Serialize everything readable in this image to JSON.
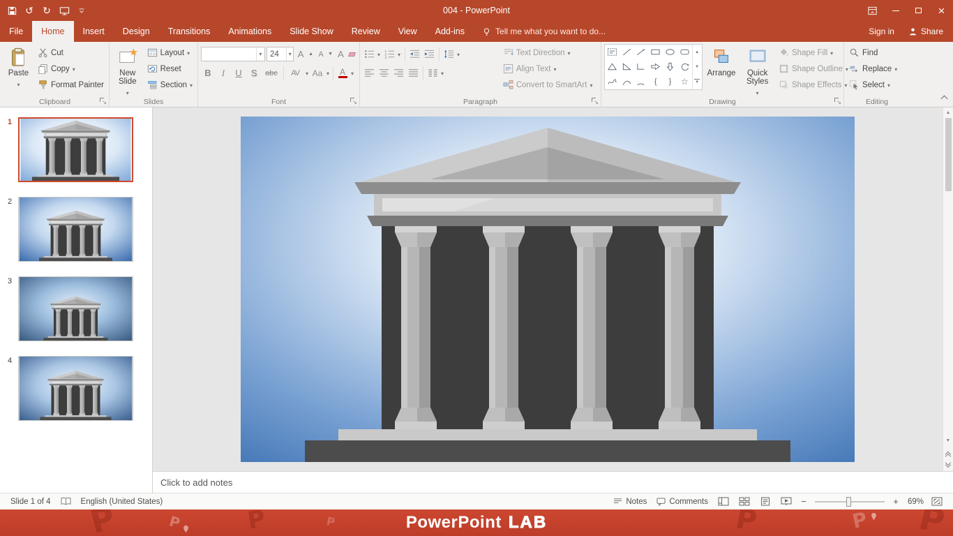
{
  "titlebar": {
    "title": "004 - PowerPoint"
  },
  "tabs": [
    {
      "label": "File"
    },
    {
      "label": "Home"
    },
    {
      "label": "Insert"
    },
    {
      "label": "Design"
    },
    {
      "label": "Transitions"
    },
    {
      "label": "Animations"
    },
    {
      "label": "Slide Show"
    },
    {
      "label": "Review"
    },
    {
      "label": "View"
    },
    {
      "label": "Add-ins"
    }
  ],
  "tellme": "Tell me what you want to do...",
  "account": {
    "signin": "Sign in",
    "share": "Share"
  },
  "ribbon": {
    "clipboard": {
      "label": "Clipboard",
      "paste": "Paste",
      "cut": "Cut",
      "copy": "Copy",
      "format_painter": "Format Painter"
    },
    "slides": {
      "label": "Slides",
      "new_slide": "New Slide",
      "layout": "Layout",
      "reset": "Reset",
      "section": "Section"
    },
    "font": {
      "label": "Font",
      "size": "24",
      "bold": "B",
      "italic": "I",
      "underline": "U",
      "shadow": "S",
      "strikethrough": "abc",
      "spacing": "AV",
      "change_case": "Aa",
      "font_color": "A"
    },
    "paragraph": {
      "label": "Paragraph",
      "text_direction": "Text Direction",
      "align_text": "Align Text",
      "smartart": "Convert to SmartArt"
    },
    "drawing": {
      "label": "Drawing",
      "arrange": "Arrange",
      "quick_styles": "Quick Styles",
      "shape_fill": "Shape Fill",
      "shape_outline": "Shape Outline",
      "shape_effects": "Shape Effects"
    },
    "editing": {
      "label": "Editing",
      "find": "Find",
      "replace": "Replace",
      "select": "Select"
    }
  },
  "slide_panel": {
    "slides": [
      {
        "num": "1"
      },
      {
        "num": "2"
      },
      {
        "num": "3"
      },
      {
        "num": "4"
      }
    ]
  },
  "notes": {
    "placeholder": "Click to add notes"
  },
  "statusbar": {
    "slide_indicator": "Slide 1 of 4",
    "language": "English (United States)",
    "notes_label": "Notes",
    "comments_label": "Comments",
    "zoom_level": "69%"
  },
  "banner": {
    "brand": "PowerPoint",
    "brand_suffix": "LAB",
    "decor_letter": "P"
  }
}
